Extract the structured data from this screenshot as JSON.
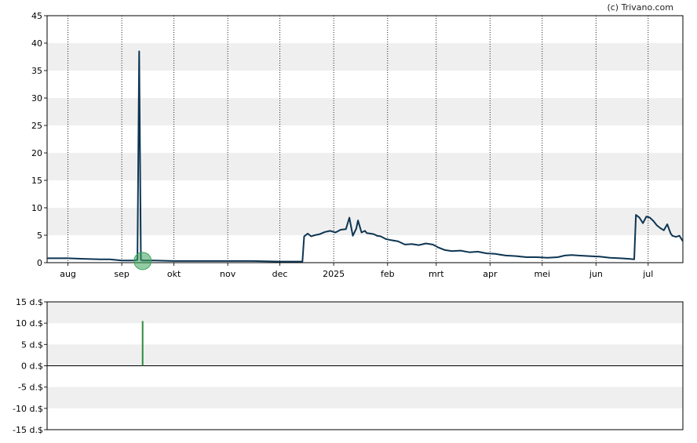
{
  "copyright": "(c) Trivano.com",
  "chart_data": [
    {
      "type": "line",
      "x_tick_labels": [
        "aug",
        "sep",
        "okt",
        "nov",
        "dec",
        "2025",
        "feb",
        "mrt",
        "apr",
        "mei",
        "jun",
        "jul"
      ],
      "x_tick_dates": [
        "2024-08-01",
        "2024-09-01",
        "2024-10-01",
        "2024-11-01",
        "2024-12-01",
        "2025-01-01",
        "2025-02-01",
        "2025-03-01",
        "2025-04-01",
        "2025-05-01",
        "2025-06-01",
        "2025-07-01"
      ],
      "xlim": [
        "2024-07-20",
        "2025-07-21"
      ],
      "ylim": [
        0,
        45
      ],
      "y_ticks": [
        0,
        5,
        10,
        15,
        20,
        25,
        30,
        35,
        40,
        45
      ],
      "grid": "alternating horizontal bands, dotted vertical month lines",
      "line_color": "#0d3552",
      "marker": {
        "x": "2024-09-13",
        "y": 0.3,
        "color": "#3aa35a"
      },
      "series": [
        {
          "x": [
            "2024-07-20",
            "2024-07-25",
            "2024-08-01",
            "2024-08-10",
            "2024-08-20",
            "2024-08-25",
            "2024-09-01",
            "2024-09-05",
            "2024-09-08",
            "2024-09-10",
            "2024-09-11",
            "2024-09-12",
            "2024-09-13",
            "2024-09-15",
            "2024-09-20",
            "2024-10-01",
            "2024-10-15",
            "2024-11-01",
            "2024-11-15",
            "2024-12-01",
            "2024-12-14",
            "2024-12-15",
            "2024-12-17",
            "2024-12-19",
            "2024-12-21",
            "2024-12-24",
            "2024-12-27",
            "2024-12-30",
            "2025-01-02",
            "2025-01-05",
            "2025-01-08",
            "2025-01-10",
            "2025-01-12",
            "2025-01-14",
            "2025-01-15",
            "2025-01-17",
            "2025-01-19",
            "2025-01-20",
            "2025-01-22",
            "2025-01-24",
            "2025-01-26",
            "2025-01-28",
            "2025-01-31",
            "2025-02-03",
            "2025-02-07",
            "2025-02-11",
            "2025-02-15",
            "2025-02-19",
            "2025-02-23",
            "2025-02-27",
            "2025-03-02",
            "2025-03-06",
            "2025-03-10",
            "2025-03-15",
            "2025-03-20",
            "2025-03-25",
            "2025-03-30",
            "2025-04-04",
            "2025-04-10",
            "2025-04-16",
            "2025-04-22",
            "2025-04-28",
            "2025-05-04",
            "2025-05-10",
            "2025-05-14",
            "2025-05-18",
            "2025-05-22",
            "2025-05-28",
            "2025-06-03",
            "2025-06-09",
            "2025-06-15",
            "2025-06-20",
            "2025-06-23",
            "2025-06-24",
            "2025-06-26",
            "2025-06-28",
            "2025-06-30",
            "2025-07-02",
            "2025-07-04",
            "2025-07-06",
            "2025-07-08",
            "2025-07-10",
            "2025-07-12",
            "2025-07-14",
            "2025-07-15",
            "2025-07-17",
            "2025-07-19",
            "2025-07-21"
          ],
          "y": [
            0.8,
            0.8,
            0.8,
            0.7,
            0.6,
            0.6,
            0.4,
            0.4,
            0.4,
            0.5,
            38.5,
            0.5,
            0.4,
            0.4,
            0.4,
            0.3,
            0.3,
            0.3,
            0.3,
            0.2,
            0.2,
            4.8,
            5.3,
            4.8,
            5.0,
            5.2,
            5.6,
            5.8,
            5.5,
            6.0,
            6.1,
            8.2,
            4.9,
            6.2,
            7.7,
            5.5,
            5.8,
            5.4,
            5.3,
            5.2,
            4.9,
            4.8,
            4.3,
            4.1,
            3.9,
            3.3,
            3.4,
            3.2,
            3.5,
            3.3,
            2.8,
            2.3,
            2.1,
            2.2,
            1.9,
            2.0,
            1.7,
            1.6,
            1.3,
            1.2,
            1.0,
            1.0,
            0.9,
            1.0,
            1.3,
            1.4,
            1.3,
            1.2,
            1.1,
            0.9,
            0.8,
            0.7,
            0.6,
            8.7,
            8.2,
            7.2,
            8.4,
            8.2,
            7.6,
            6.8,
            6.3,
            5.9,
            7.0,
            5.3,
            4.9,
            4.7,
            4.9,
            3.9
          ]
        }
      ]
    },
    {
      "type": "bar",
      "xlim": [
        "2024-07-20",
        "2025-07-21"
      ],
      "ylim": [
        -15,
        15
      ],
      "y_tick_labels": [
        "15 d.$",
        "10 d.$",
        "5 d.$",
        "0 d.$",
        "-5 d.$",
        "-10 d.$",
        "-15 d.$"
      ],
      "y_ticks": [
        15,
        10,
        5,
        0,
        -5,
        -10,
        -15
      ],
      "grid": "alternating horizontal bands",
      "bar_color": "#2e8b3e",
      "bars": [
        {
          "x": "2024-09-13",
          "value": 10.5
        }
      ]
    }
  ]
}
